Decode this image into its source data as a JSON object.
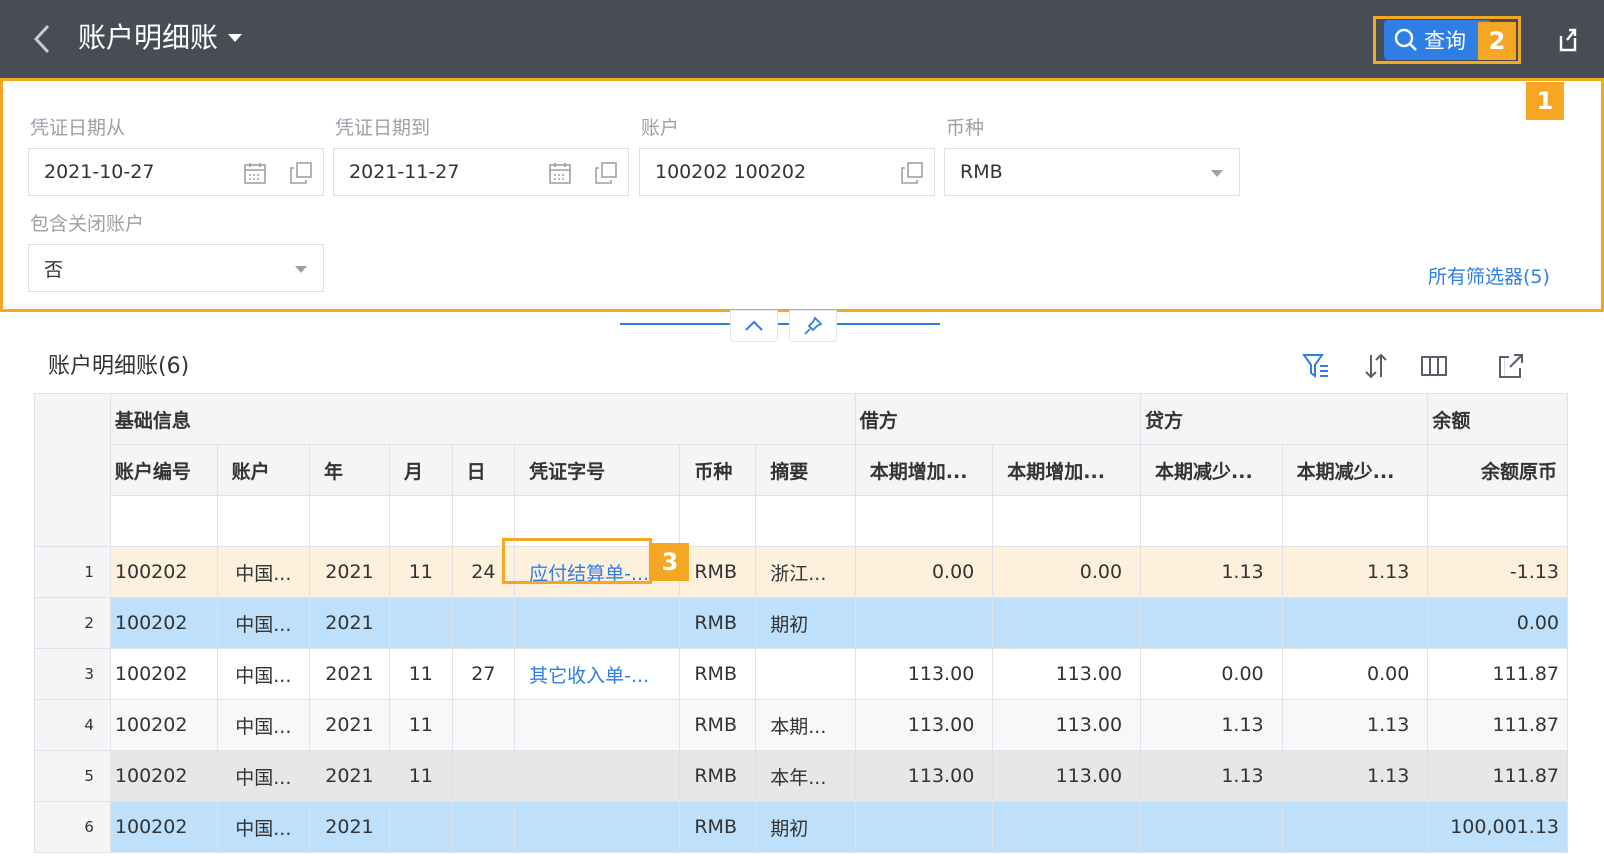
{
  "header": {
    "title": "账户明细账",
    "query_label": "查询",
    "badge_query": "2",
    "badge_filter": "1",
    "badge_voucher": "3"
  },
  "filters": {
    "date_from": {
      "label": "凭证日期从",
      "value": "2021-10-27"
    },
    "date_to": {
      "label": "凭证日期到",
      "value": "2021-11-27"
    },
    "account": {
      "label": "账户",
      "value": "100202 100202"
    },
    "currency": {
      "label": "币种",
      "value": "RMB"
    },
    "include_closed": {
      "label": "包含关闭账户",
      "value": "否"
    },
    "all_filters": "所有筛选器(5)"
  },
  "grid": {
    "title": "账户明细账(6)",
    "groups": [
      "基础信息",
      "借方",
      "贷方",
      "余额"
    ],
    "columns": [
      "账户编号",
      "账户",
      "年",
      "月",
      "日",
      "凭证字号",
      "币种",
      "摘要",
      "本期增加...",
      "本期增加...",
      "本期减少...",
      "本期减少...",
      "余额原币"
    ],
    "rows": [
      {
        "n": "1",
        "code": "100202",
        "acct": "中国...",
        "year": "2021",
        "month": "11",
        "day": "24",
        "voucher": "应付结算单-...",
        "cur": "RMB",
        "memo": "浙江...",
        "d1": "0.00",
        "d2": "0.00",
        "c1": "1.13",
        "c2": "1.13",
        "bal": "-1.13"
      },
      {
        "n": "2",
        "code": "100202",
        "acct": "中国...",
        "year": "2021",
        "month": "",
        "day": "",
        "voucher": "",
        "cur": "RMB",
        "memo": "期初",
        "d1": "",
        "d2": "",
        "c1": "",
        "c2": "",
        "bal": "0.00"
      },
      {
        "n": "3",
        "code": "100202",
        "acct": "中国...",
        "year": "2021",
        "month": "11",
        "day": "27",
        "voucher": "其它收入单-...",
        "cur": "RMB",
        "memo": "",
        "d1": "113.00",
        "d2": "113.00",
        "c1": "0.00",
        "c2": "0.00",
        "bal": "111.87"
      },
      {
        "n": "4",
        "code": "100202",
        "acct": "中国...",
        "year": "2021",
        "month": "11",
        "day": "",
        "voucher": "",
        "cur": "RMB",
        "memo": "本期...",
        "d1": "113.00",
        "d2": "113.00",
        "c1": "1.13",
        "c2": "1.13",
        "bal": "111.87"
      },
      {
        "n": "5",
        "code": "100202",
        "acct": "中国...",
        "year": "2021",
        "month": "11",
        "day": "",
        "voucher": "",
        "cur": "RMB",
        "memo": "本年...",
        "d1": "113.00",
        "d2": "113.00",
        "c1": "1.13",
        "c2": "1.13",
        "bal": "111.87"
      },
      {
        "n": "6",
        "code": "100202",
        "acct": "中国...",
        "year": "2021",
        "month": "",
        "day": "",
        "voucher": "",
        "cur": "RMB",
        "memo": "期初",
        "d1": "",
        "d2": "",
        "c1": "",
        "c2": "",
        "bal": "100,001.13"
      }
    ]
  },
  "colors": {
    "accent": "#2f7ee6",
    "highlight": "#f5a623",
    "header_bg": "#474c55"
  }
}
